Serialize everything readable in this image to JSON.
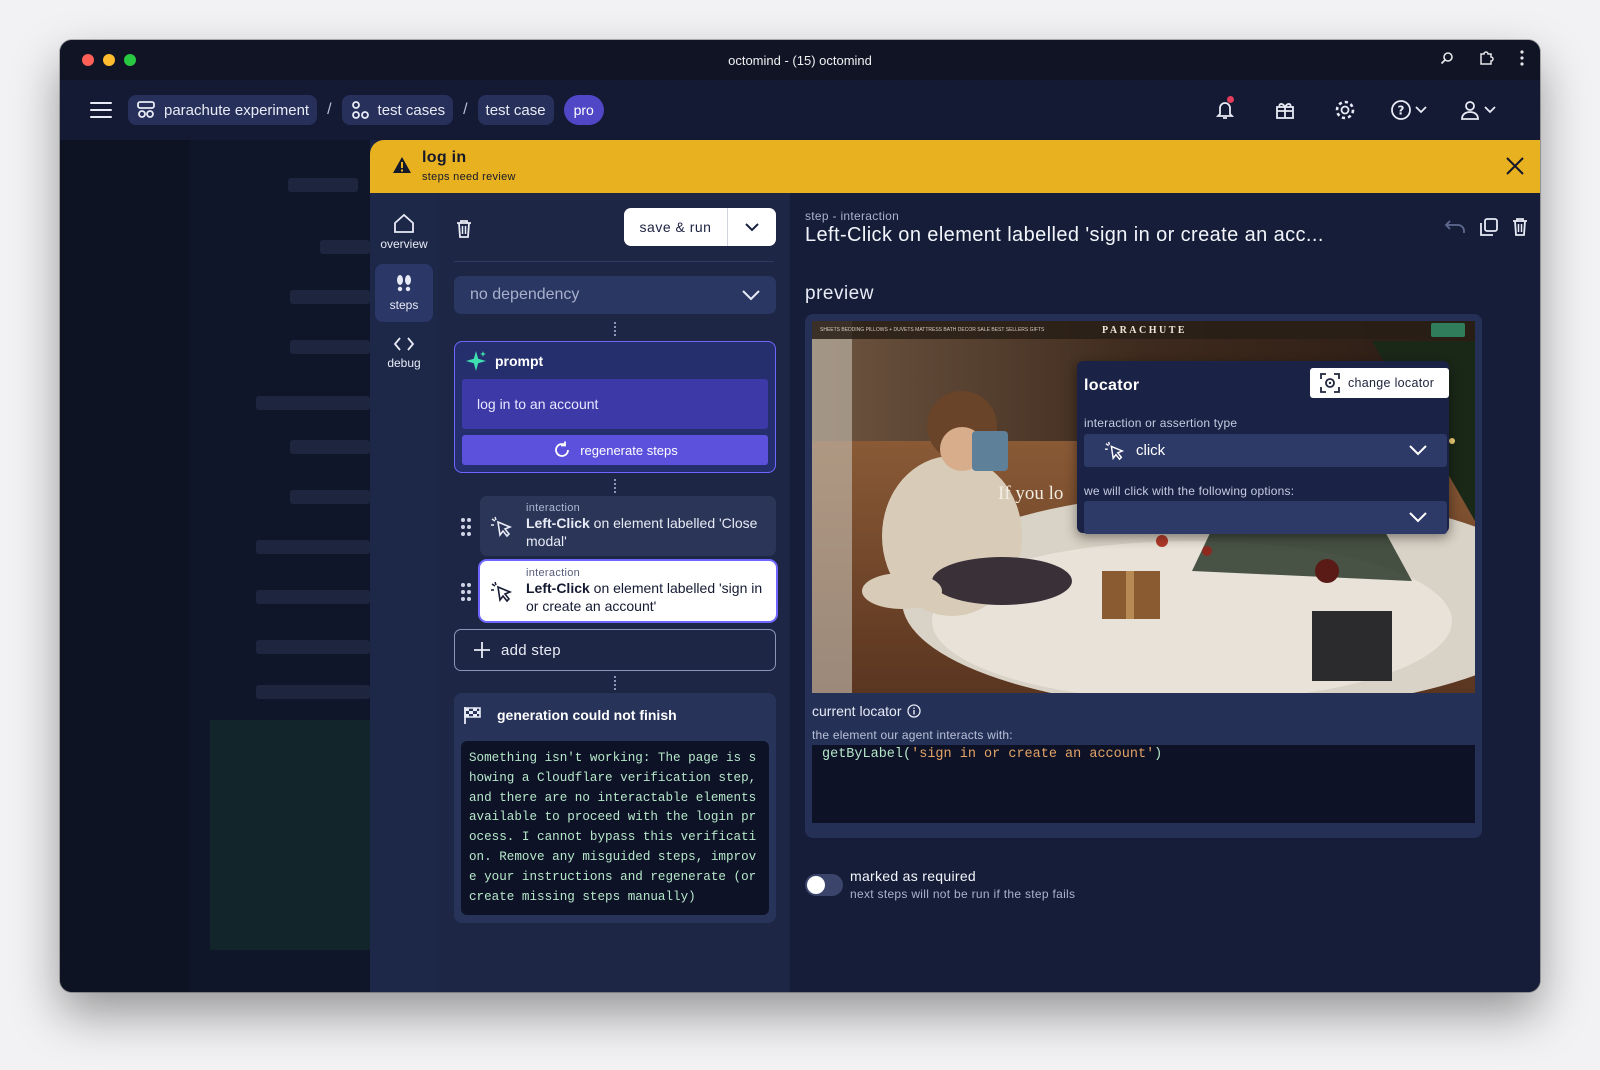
{
  "window": {
    "title": "octomind - (15) octomind"
  },
  "colors": {
    "accent": "#5c51dd",
    "warning": "#e8b11f",
    "panel": "#1b2543",
    "code_text": "#b6e7c9",
    "code_string": "#e5a365"
  },
  "breadcrumbs": [
    {
      "label": "parachute experiment",
      "icon": "project-icon"
    },
    {
      "label": "test cases",
      "icon": "test-cases-icon"
    },
    {
      "label": "test case"
    }
  ],
  "breadcrumb_separator": "/",
  "plan_badge": "pro",
  "nav_icons": [
    "notification-bell-icon",
    "gift-icon",
    "settings-gear-icon",
    "help-icon",
    "user-icon"
  ],
  "banner": {
    "title": "log in",
    "subtitle": "steps need review"
  },
  "rail": [
    {
      "label": "overview",
      "icon": "home-icon"
    },
    {
      "label": "steps",
      "icon": "footsteps-icon"
    },
    {
      "label": "debug",
      "icon": "code-icon"
    }
  ],
  "toolbar": {
    "save_label": "save & run"
  },
  "dependency": {
    "selected": "no dependency"
  },
  "prompt": {
    "header": "prompt",
    "text": "log in to an account",
    "regenerate_label": "regenerate steps"
  },
  "steps": [
    {
      "type": "interaction",
      "action": "Left-Click",
      "rest": " on element labelled 'Close modal'"
    },
    {
      "type": "interaction",
      "action": "Left-Click",
      "rest": " on element labelled 'sign in or create an account'"
    }
  ],
  "add_step_label": "add step",
  "generation": {
    "header": "generation could not finish",
    "message": "Something isn't working: The page is showing a Cloudflare verification step, and there are no interactable elements available to proceed with the login process. I cannot bypass this verification. Remove any misguided steps, improve your instructions and regenerate (or create missing steps manually)"
  },
  "detail": {
    "kind": "step - interaction",
    "title": "Left-Click on element labelled 'sign in or create an acc...",
    "preview_label": "preview",
    "site": {
      "logo": "PARACHUTE",
      "hero_text": "If you lo",
      "nav": "SHEETS  BEDDING  PILLOWS + DUVETS  MATTRESS  BATH  DECOR  SALE  BEST SELLERS  GIFTS"
    },
    "locator": {
      "title": "locator",
      "change_label": "change locator",
      "type_label": "interaction or assertion type",
      "type_value": "click",
      "options_label": "we will click with the following options:",
      "options_value": ""
    },
    "current_locator_label": "current locator",
    "current_locator_sub": "the element our agent interacts with:",
    "code": {
      "fn": "getByLabel(",
      "arg": "'sign in or create an account'",
      "close": ")"
    },
    "required": {
      "title": "marked as required",
      "sub": "next steps will not be run if the step fails",
      "on": false
    }
  }
}
